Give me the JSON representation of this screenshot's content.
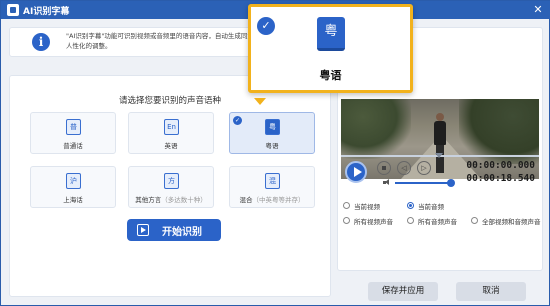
{
  "window": {
    "title": "AI识别字幕",
    "close_glyph": "✕"
  },
  "info": {
    "icon_glyph": "i",
    "text": "\"AI识别字幕\"功能可识别视频或音频里的语音内容，自动生成同步字幕，识别结果进行各种更人性化的调整。"
  },
  "languages": {
    "prompt": "请选择您要识别的声音语种",
    "items": [
      {
        "glyph": "普",
        "name": "普通话",
        "note": "",
        "selected": false
      },
      {
        "glyph": "En",
        "name": "英语",
        "note": "",
        "selected": false
      },
      {
        "glyph": "粤",
        "name": "粤语",
        "note": "",
        "selected": true
      },
      {
        "glyph": "沪",
        "name": "上海话",
        "note": "",
        "selected": false
      },
      {
        "glyph": "方",
        "name": "其他方言",
        "note": "（多达数十种）",
        "selected": false
      },
      {
        "glyph": "混",
        "name": "混合",
        "note": "（中英粤等并存）",
        "selected": false
      }
    ],
    "check_glyph": "✓",
    "start_label": "开始识别"
  },
  "popup": {
    "glyph": "粤",
    "name": "粤语",
    "check_glyph": "✓"
  },
  "player": {
    "time_current": "00:00:00.000",
    "time_total": "00:00:18.540",
    "volume": 0.9,
    "buttons": {
      "prev_glyph": "◁",
      "next_glyph": "▷"
    }
  },
  "options": [
    {
      "label": "当前视频",
      "checked": false
    },
    {
      "label": "当前音频",
      "checked": true
    },
    {
      "label": "所有视频声音",
      "checked": false
    },
    {
      "label": "所有音频声音",
      "checked": false
    },
    {
      "label": "全部视频和音频声音",
      "checked": false
    }
  ],
  "footer": {
    "apply_label": "保存并应用",
    "cancel_label": "取消"
  },
  "colors": {
    "accent": "#2b63c8",
    "popup_border": "#f2b21c",
    "titlebar": "#2b61b6"
  }
}
